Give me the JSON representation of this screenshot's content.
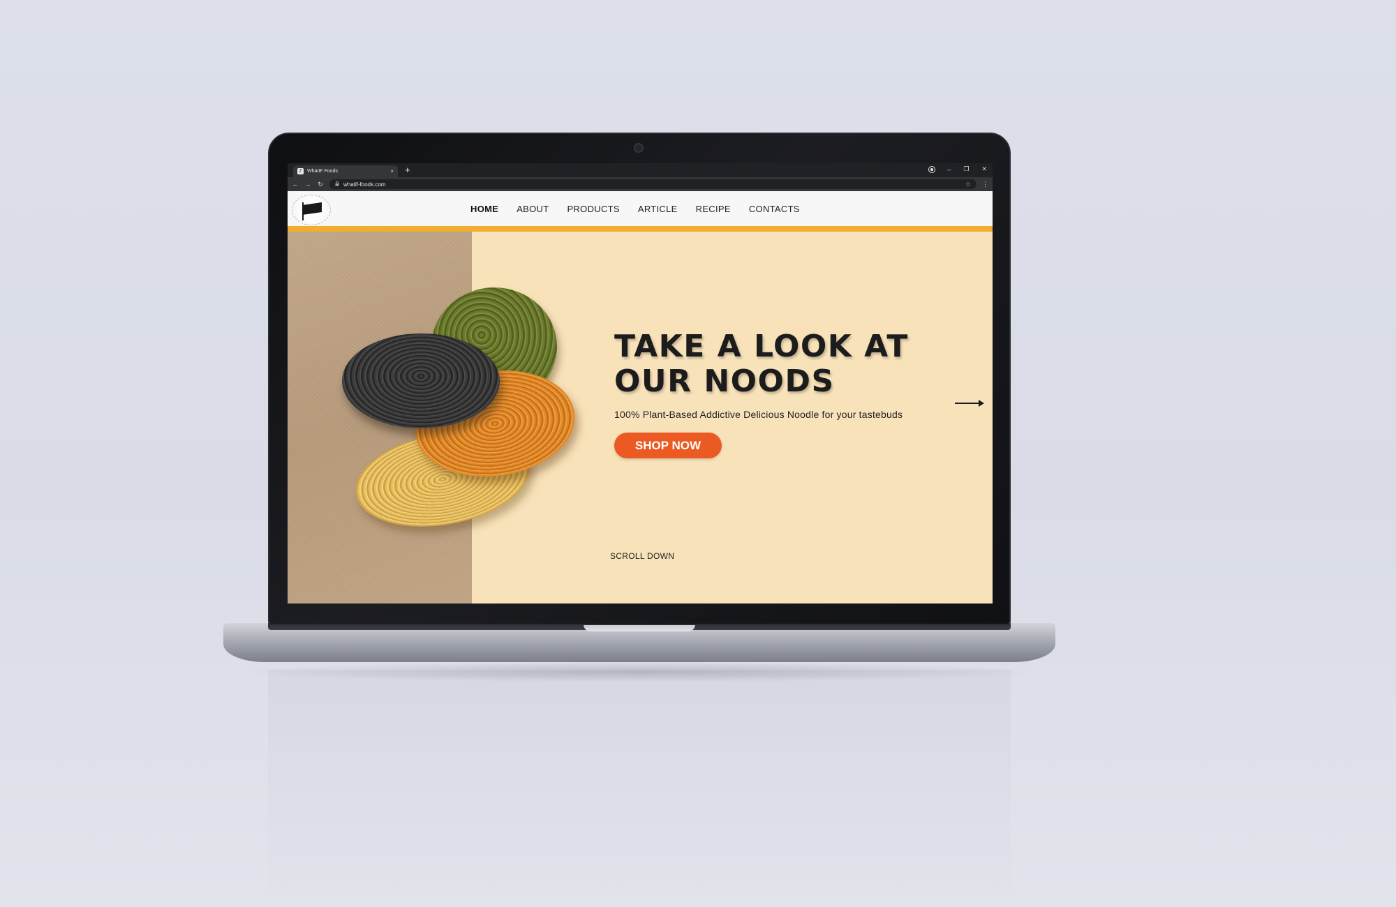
{
  "browser": {
    "tab_title": "WhatIF Foods",
    "tab_favicon": "Z",
    "url": "whatif-foods.com",
    "icons": [
      "back-icon",
      "forward-icon",
      "reload-icon",
      "lock-icon",
      "star-icon",
      "menu-icon",
      "profile-icon",
      "minimize-icon",
      "maximize-icon",
      "close-icon"
    ],
    "glyphs": {
      "close": "×",
      "new_tab": "+",
      "back": "←",
      "forward": "→",
      "reload": "↻",
      "star": "☆",
      "menu": "⋮",
      "minimize": "–",
      "maximize": "❐",
      "window_close": "✕"
    }
  },
  "site": {
    "nav": [
      {
        "label": "HOME",
        "active": true
      },
      {
        "label": "ABOUT"
      },
      {
        "label": "PRODUCTS"
      },
      {
        "label": "ARTICLE"
      },
      {
        "label": "RECIPE"
      },
      {
        "label": "CONTACTS"
      }
    ],
    "hero": {
      "headline_line1": "TAKE A LOOK AT",
      "headline_line2": "OUR NOODS",
      "tagline": "100% Plant-Based Addictive Delicious Noodle for your tastebuds",
      "cta": "SHOP NOW",
      "scroll_hint": "SCROLL DOWN"
    },
    "colors": {
      "accent_bar": "#f0ad2e",
      "hero_bg": "#f8e2b9",
      "cta_bg": "#ea5a22"
    }
  }
}
